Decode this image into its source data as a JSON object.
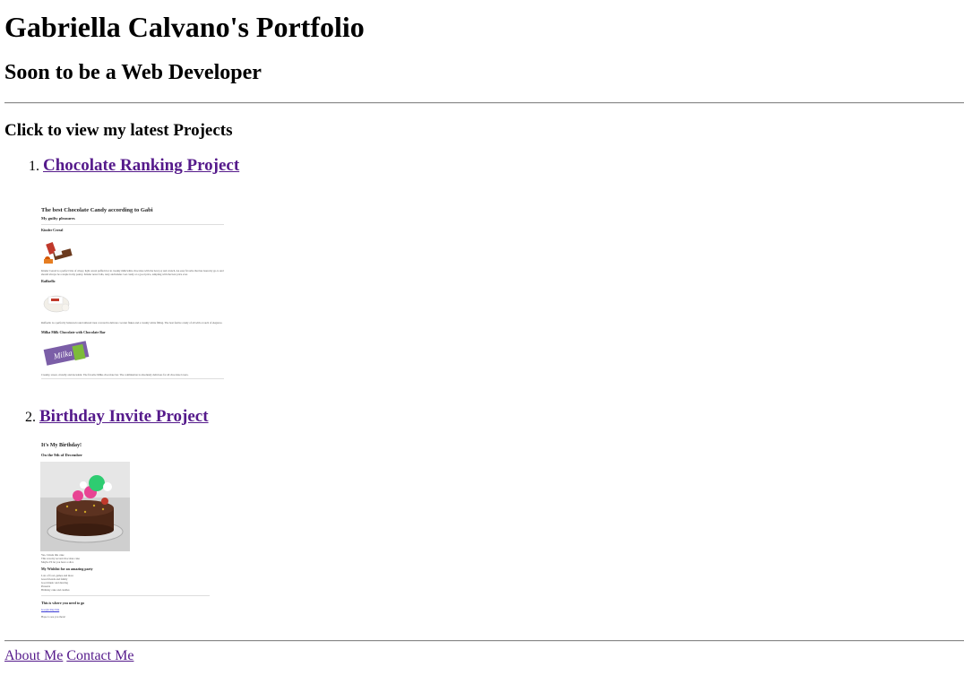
{
  "header": {
    "title": "Gabriella Calvano's Portfolio",
    "subtitle": "Soon to be a Web Developer"
  },
  "projects_heading": "Click to view my latest Projects",
  "projects": [
    {
      "number": "1.",
      "label": "Chocolate Ranking Project",
      "thumbnail": {
        "title": "The best Chocolate Candy according to Gabi",
        "subtitle": "My guilty pleasures",
        "items": [
          {
            "name": "Kinder Cereal",
            "text": "Kinder Cereal is a perfect bite of crispy, light cereal puffed rice in creamy milk/white chocolate with the best joy and crunch. An easy favorite that has been my go-to and should always be a staple in my pantry. Kinder never fails, tasty and kinder. Get candy at a good price, tempting with the best price ever."
          },
          {
            "name": "Raffaello",
            "text": "Raffaello is a perfectly balanced round almond treat covered in delicate coconut flakes and a creamy white filling. The best festive candy of all with a touch of elegance."
          },
          {
            "name": "Milka Milk Chocolate with Chocolate Bar",
            "text": "Creamy, sweet, crunchy and decadent. The favorite Milka chocolate bar. The combination is absolutely delicious for all chocolate lovers."
          }
        ]
      }
    },
    {
      "number": "2.",
      "label": "Birthday Invite Project",
      "thumbnail": {
        "title": "It's My Birthday!",
        "subtitle": "On the 9th of December",
        "bullets": [
          "Yes, I made this cake",
          "This was my second chocolate cake",
          "Maybe I'll let you have a slice"
        ],
        "wishlist_heading": "My Wishlist for an amazing party",
        "wishlist": [
          "Lots of food, games and more",
          "Great friends and family",
          "Good music and dancing",
          "Presents",
          "Birthday cake and candles"
        ],
        "address_heading": "This is where you need to go",
        "link_text": "Google map link",
        "closing": "Hope to see you there!"
      }
    }
  ],
  "footer": {
    "about": "About Me",
    "contact": "Contact Me"
  },
  "colors": {
    "link_visited": "#551a8b",
    "rule": "#8a8a8a"
  }
}
